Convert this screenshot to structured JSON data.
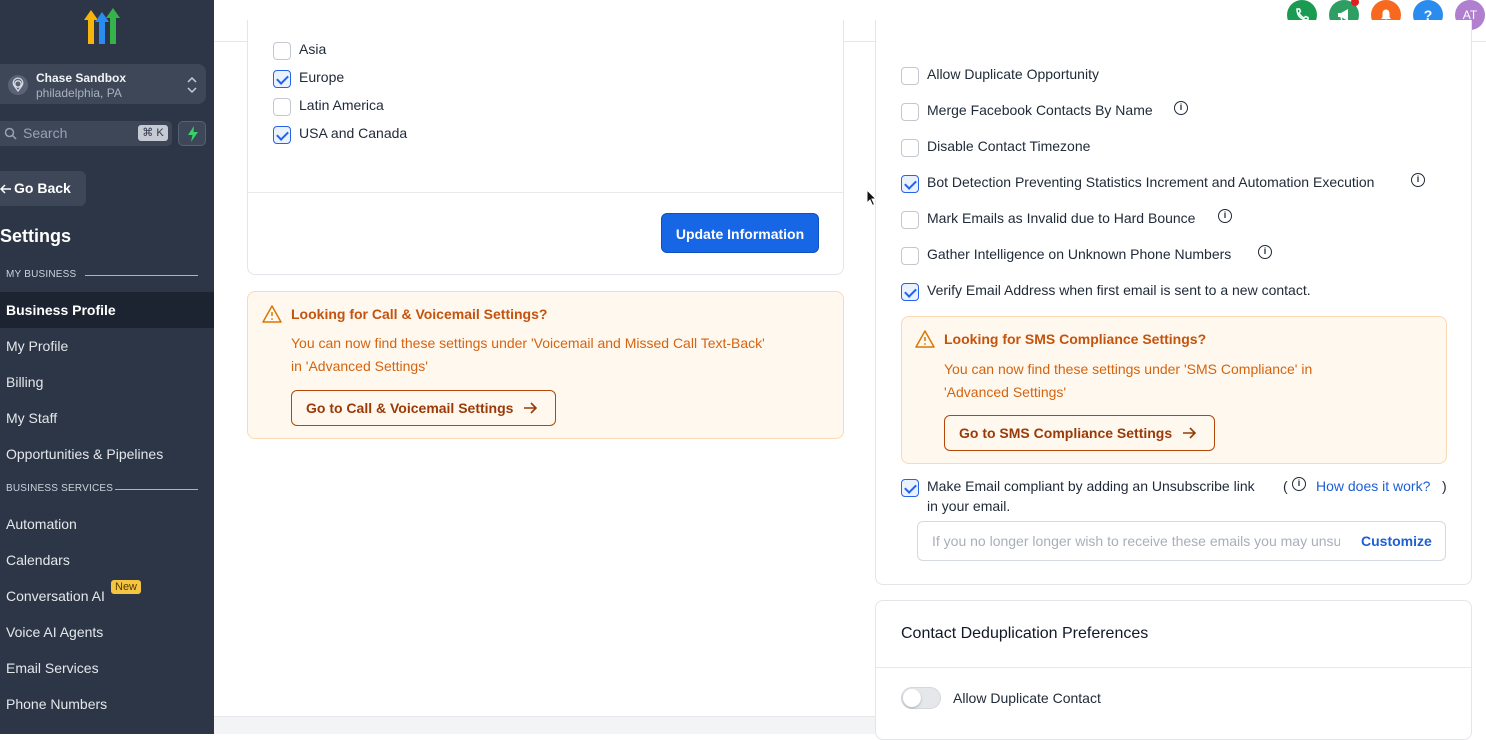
{
  "sidebar": {
    "location_name": "Chase Sandbox",
    "location_city": "philadelphia, PA",
    "search_placeholder": "Search",
    "search_shortcut": "⌘ K",
    "go_back": "Go Back",
    "settings_title": "Settings",
    "section_my_business": "MY BUSINESS",
    "section_business_services": "BUSINESS SERVICES",
    "items": [
      "Business Profile",
      "My Profile",
      "Billing",
      "My Staff",
      "Opportunities & Pipelines",
      "Automation",
      "Calendars",
      "Conversation AI",
      "Voice AI Agents",
      "Email Services",
      "Phone Numbers"
    ],
    "new_badge": "New"
  },
  "topbar": {
    "avatar_initials": "AT",
    "help_icon": "?",
    "colors": {
      "phone": "#1a9b52",
      "megaphone": "#2f9e63",
      "bell": "#f7691e",
      "help": "#2b8cf0",
      "avatar": "#b07fcf"
    }
  },
  "regions": {
    "items": [
      {
        "label": "Asia",
        "checked": false
      },
      {
        "label": "Europe",
        "checked": true
      },
      {
        "label": "Latin America",
        "checked": false
      },
      {
        "label": "USA and Canada",
        "checked": true
      }
    ],
    "update_button": "Update Information"
  },
  "call_notice": {
    "title": "Looking for Call & Voicemail Settings?",
    "body_line1": "You can now find these settings under 'Voicemail and Missed Call Text-Back'",
    "body_line2": "in 'Advanced Settings'",
    "button": "Go to Call & Voicemail Settings"
  },
  "options": {
    "items": [
      {
        "label": "Allow Duplicate Opportunity",
        "checked": false
      },
      {
        "label": "Merge Facebook Contacts By Name",
        "checked": false
      },
      {
        "label": "Disable Contact Timezone",
        "checked": false
      },
      {
        "label": "Bot Detection Preventing Statistics Increment and Automation Execution",
        "checked": true
      },
      {
        "label": "Mark Emails as Invalid due to Hard Bounce",
        "checked": false
      },
      {
        "label": "Gather Intelligence on Unknown Phone Numbers",
        "checked": false
      },
      {
        "label": "Verify Email Address when first email is sent to a new contact.",
        "checked": true
      }
    ]
  },
  "sms_notice": {
    "title": "Looking for SMS Compliance Settings?",
    "body_line1": "You can now find these settings under 'SMS Compliance' in",
    "body_line2": "'Advanced Settings'",
    "button": "Go to SMS Compliance Settings"
  },
  "unsubscribe": {
    "label_line1": "Make Email compliant by adding an Unsubscribe link",
    "label_line2": "in your email.",
    "paren_open": "(",
    "paren_close": ")",
    "how_link": "How does it work?",
    "placeholder": "If you no longer longer wish to receive these emails you may unsubscribe",
    "customize": "Customize"
  },
  "dedup": {
    "title": "Contact Deduplication Preferences",
    "allow_duplicate_contact": "Allow Duplicate Contact",
    "toggle_on": false
  }
}
